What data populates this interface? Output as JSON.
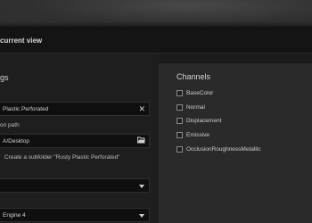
{
  "header": {
    "title": "current view"
  },
  "settings": {
    "section_title": "gs",
    "name_field": {
      "value": "Plastic Perforated",
      "clear_icon": "close-icon"
    },
    "path_label": "on path",
    "path_field": {
      "value": "A/Desktop",
      "browse_icon": "folder-open-icon"
    },
    "subfolder_label": "Create a subfolder \"Rusty Plastic Perforated\"",
    "dropdown_1": {
      "value": ""
    },
    "dropdown_2": {
      "value": "Engine 4"
    }
  },
  "channels": {
    "title": "Channels",
    "items": [
      {
        "label": "BaseColor",
        "checked": false
      },
      {
        "label": "Normal",
        "checked": false
      },
      {
        "label": "Displacement",
        "checked": false
      },
      {
        "label": "Emissive",
        "checked": false
      },
      {
        "label": "OcclusionRoughnessMetallic",
        "checked": false
      }
    ]
  }
}
